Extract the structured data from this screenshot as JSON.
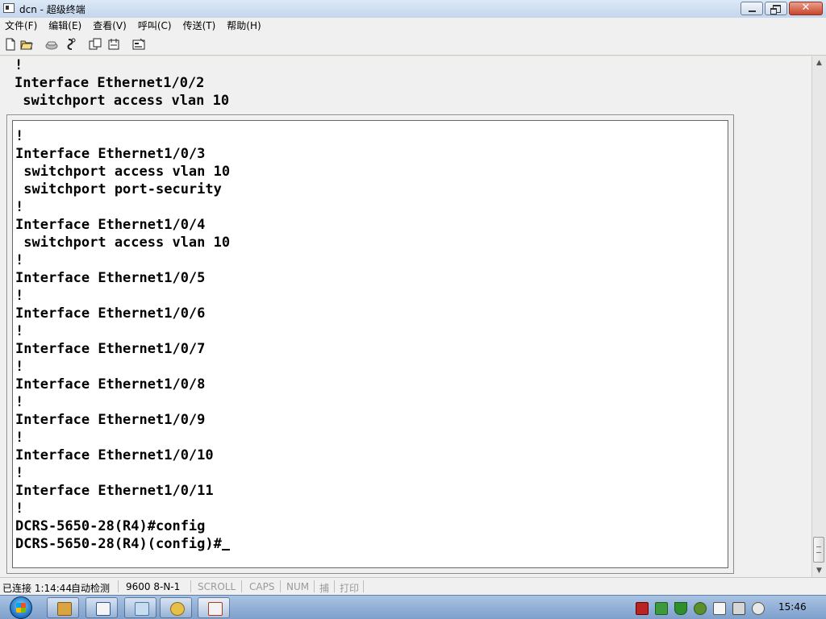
{
  "window": {
    "title": "dcn - 超级终端",
    "controls": {
      "close_glyph": "✕"
    }
  },
  "menu": [
    "文件(F)",
    "编辑(E)",
    "查看(V)",
    "呼叫(C)",
    "传送(T)",
    "帮助(H)"
  ],
  "toolbar_icons": [
    "new-file-icon",
    "open-folder-icon",
    "phone-icon",
    "disconnect-icon",
    "send-icon",
    "receive-icon",
    "properties-icon"
  ],
  "terminal": {
    "behind_lines": [
      "!",
      "Interface Ethernet1/0/2",
      " switchport access vlan 10"
    ],
    "lines": [
      "!",
      "Interface Ethernet1/0/3",
      " switchport access vlan 10",
      " switchport port-security",
      "!",
      "Interface Ethernet1/0/4",
      " switchport access vlan 10",
      "!",
      "Interface Ethernet1/0/5",
      "!",
      "Interface Ethernet1/0/6",
      "!",
      "Interface Ethernet1/0/7",
      "!",
      "Interface Ethernet1/0/8",
      "!",
      "Interface Ethernet1/0/9",
      "!",
      "Interface Ethernet1/0/10",
      "!",
      "Interface Ethernet1/0/11",
      "!",
      "DCRS-5650-28(R4)#config"
    ],
    "prompt": "DCRS-5650-28(R4)(config)#"
  },
  "status": {
    "connection": "已连接 1:14:44",
    "detect": "自动检测",
    "port": "9600 8-N-1",
    "scroll": "SCROLL",
    "caps": "CAPS",
    "num": "NUM",
    "capture": "捕",
    "print": "打印"
  },
  "taskbar": {
    "apps": [
      "file-manager-icon",
      "word-icon",
      "explorer-icon",
      "network-icon",
      "hyperterminal-icon"
    ],
    "tray": [
      "network-tray-icon",
      "volume-icon",
      "security-icon",
      "ime-icon",
      "flag-icon",
      "usb-icon",
      "monitor-icon",
      "speaker-icon"
    ],
    "clock": "15:46"
  },
  "colors": {
    "terminal_bg": "#ffffff",
    "chrome_bg": "#f0f0f0",
    "taskbar": "#8fb0d8"
  }
}
